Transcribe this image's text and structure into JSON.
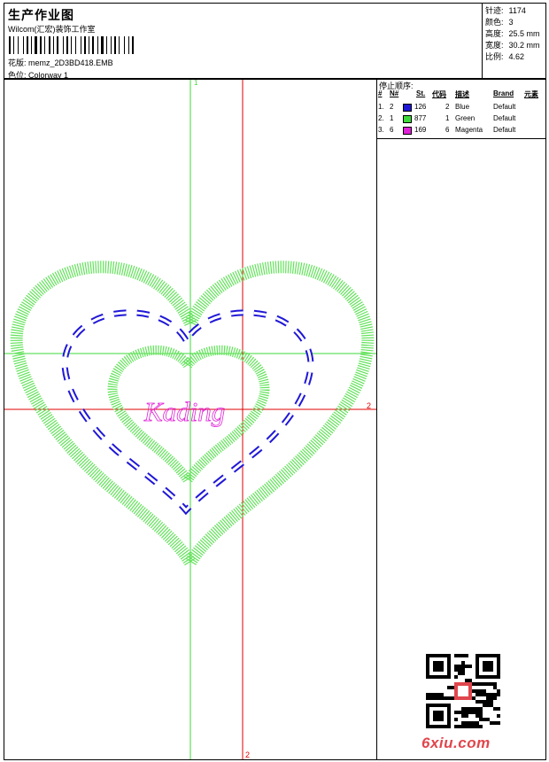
{
  "header": {
    "title": "生产作业图",
    "studio": "Wilcom(汇宏)装饰工作室",
    "file_label": "花版:",
    "file_name": "memz_2D3BD418.EMB",
    "colorway_label": "色位:",
    "colorway_name": "Colorway 1"
  },
  "stats": [
    {
      "label": "针迹:",
      "value": "1174"
    },
    {
      "label": "颜色:",
      "value": "3"
    },
    {
      "label": "高度:",
      "value": "25.5 mm"
    },
    {
      "label": "宽度:",
      "value": "30.2 mm"
    },
    {
      "label": "比例:",
      "value": "4.62"
    }
  ],
  "stop_sequence": {
    "title": "停止顺序:",
    "headers": [
      "#",
      "N#",
      "St.",
      "代码",
      "描述",
      "Brand",
      "元素"
    ],
    "rows": [
      {
        "num": "1.",
        "n": "2",
        "color": "#1f17d6",
        "stitches": "126",
        "code": "2",
        "desc": "Blue",
        "brand": "Default"
      },
      {
        "num": "2.",
        "n": "1",
        "color": "#3ed83a",
        "stitches": "877",
        "code": "1",
        "desc": "Green",
        "brand": "Default"
      },
      {
        "num": "3.",
        "n": "6",
        "color": "#e01fd8",
        "stitches": "169",
        "code": "6",
        "desc": "Magenta",
        "brand": "Default"
      }
    ]
  },
  "design": {
    "axis_v_green_label": "1",
    "axis_h_red_label": "2",
    "axis_v_red_label": "2",
    "lettering": "Kading",
    "colors": {
      "outer": "#62e25a",
      "stitch": "#1f17d6",
      "text": "#e01fd8",
      "axis_green": "#3ed83a",
      "axis_red": "#e00000"
    }
  },
  "watermark": "6xiu.com"
}
